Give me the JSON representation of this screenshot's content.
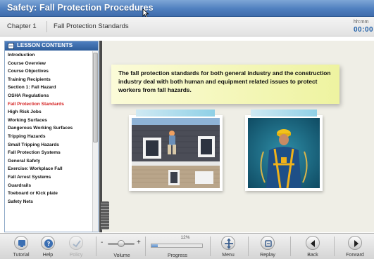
{
  "window": {
    "title": "Safety: Fall Protection Procedures"
  },
  "breadcrumb": {
    "chapter": "Chapter 1",
    "section": "Fall Protection Standards"
  },
  "timer": {
    "label": "hh:mm",
    "value": "00:00"
  },
  "sidebar": {
    "header": "LESSON CONTENTS",
    "items": [
      {
        "label": "Introduction",
        "active": false
      },
      {
        "label": "Course Overview",
        "active": false
      },
      {
        "label": "Course Objectives",
        "active": false
      },
      {
        "label": "Training Recipients",
        "active": false
      },
      {
        "label": "Section 1: Fall Hazard",
        "active": false
      },
      {
        "label": "OSHA Regulations",
        "active": false
      },
      {
        "label": "Fall Protection Standards",
        "active": true
      },
      {
        "label": "High Risk Jobs",
        "active": false
      },
      {
        "label": "Working Surfaces",
        "active": false
      },
      {
        "label": "Dangerous Working Surfaces",
        "active": false
      },
      {
        "label": "Tripping Hazards",
        "active": false
      },
      {
        "label": "Small Tripping Hazards",
        "active": false
      },
      {
        "label": "Fall Protection Systems",
        "active": false
      },
      {
        "label": "General Safety",
        "active": false
      },
      {
        "label": "Exercise: Workplace Fall",
        "active": false
      },
      {
        "label": "Fall Arrest Systems",
        "active": false
      },
      {
        "label": "Guardrails",
        "active": false
      },
      {
        "label": "Toeboard or Kick plate",
        "active": false
      },
      {
        "label": "Safety Nets",
        "active": false
      }
    ],
    "active_color": "#d42020"
  },
  "content": {
    "callout_text": "The fall protection standards for both general industry and the construction industry deal with both human and equipment related issues to protect workers from fall hazards."
  },
  "toolbar": {
    "tutorial": "Tutorial",
    "help": "Help",
    "policy": "Policy",
    "volume_label": "Volume",
    "volume_minus": "-",
    "volume_plus": "+",
    "progress_label": "Progress",
    "progress_percent_text": "12%",
    "progress_value": 0.12,
    "menu": "Menu",
    "replay": "Replay",
    "back": "Back",
    "forward": "Forward"
  },
  "colors": {
    "title_bar": "#4f7fbf",
    "timer": "#1f5fa8",
    "callout": "#eef3a0"
  }
}
